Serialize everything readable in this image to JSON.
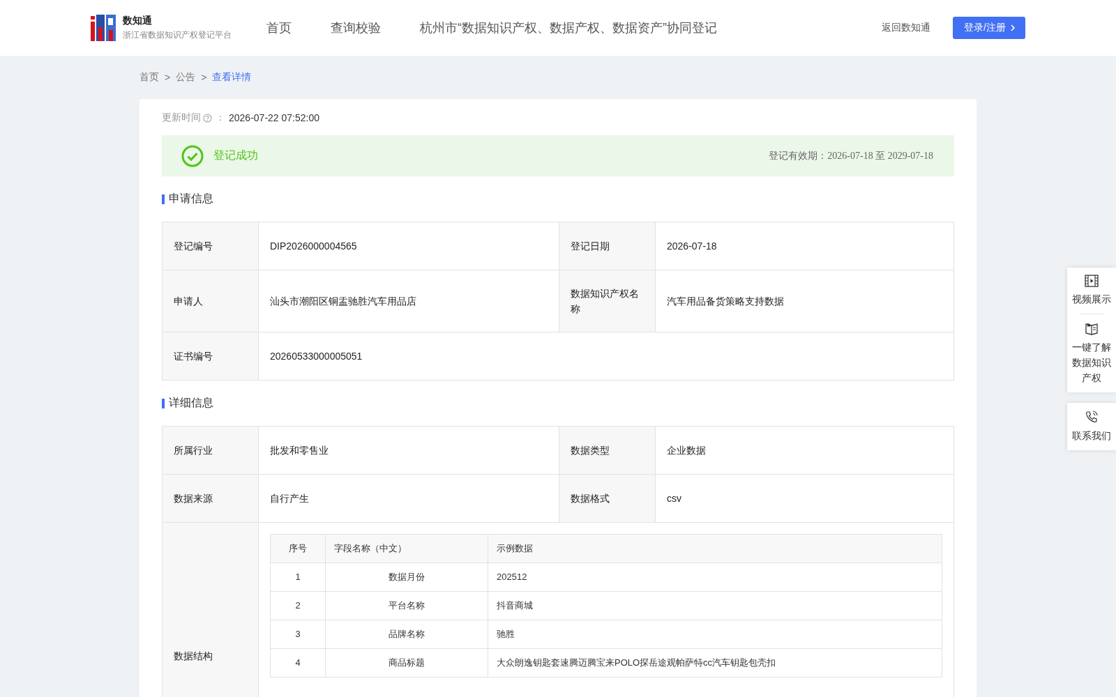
{
  "header": {
    "logo_title": "数知通",
    "logo_subtitle": "浙江省数据知识产权登记平台",
    "nav": [
      {
        "label": "首页",
        "selected": false
      },
      {
        "label": "查询校验",
        "selected": false
      },
      {
        "label": "杭州市“数据知识产权、数据产权、数据资产”协同登记",
        "selected": false
      }
    ],
    "back_link": "返回数知通",
    "login_button": "登录/注册"
  },
  "breadcrumb": [
    {
      "label": "首页",
      "selected": false
    },
    {
      "label": "公告",
      "selected": false
    },
    {
      "label": "查看详情",
      "selected": true
    }
  ],
  "breadcrumb_separator": ">",
  "update": {
    "label": "更新时间",
    "colon": "：",
    "value": "2026-07-22 07:52:00"
  },
  "status": {
    "text": "登记成功",
    "validity": "登记有效期：2026-07-18 至 2029-07-18"
  },
  "sections": [
    {
      "title": "申请信息",
      "rows": [
        [
          {
            "label": "登记编号",
            "value": "DIP2026000004565"
          },
          {
            "label": "登记日期",
            "value": "2026-07-18"
          }
        ],
        [
          {
            "label": "申请人",
            "value": "汕头市潮阳区铜盂驰胜汽车用品店"
          },
          {
            "label": "数据知识产权名称",
            "value": "汽车用品备货策略支持数据"
          }
        ],
        [
          {
            "label": "证书编号",
            "value": "20260533000005051"
          }
        ]
      ]
    },
    {
      "title": "详细信息",
      "rows": [
        [
          {
            "label": "所属行业",
            "value": "批发和零售业"
          },
          {
            "label": "数据类型",
            "value": "企业数据"
          }
        ],
        [
          {
            "label": "数据来源",
            "value": "自行产生"
          },
          {
            "label": "数据格式",
            "value": "csv"
          }
        ]
      ],
      "structure": {
        "label": "数据结构",
        "columns": [
          "序号",
          "字段名称（中文）",
          "示例数据"
        ],
        "rows": [
          [
            "1",
            "数据月份",
            "202512"
          ],
          [
            "2",
            "平台名称",
            "抖音商城"
          ],
          [
            "3",
            "品牌名称",
            "驰胜"
          ],
          [
            "4",
            "商品标题",
            "大众朗逸钥匙套速腾迈腾宝来POLO探岳途观帕萨特cc汽车钥匙包壳扣"
          ]
        ]
      }
    }
  ],
  "side_panel": [
    {
      "kind": "video",
      "label": "视频展示"
    },
    {
      "kind": "book",
      "label": "一键了解数据知识产权"
    },
    {
      "kind": "phone",
      "label": "联系我们"
    }
  ]
}
